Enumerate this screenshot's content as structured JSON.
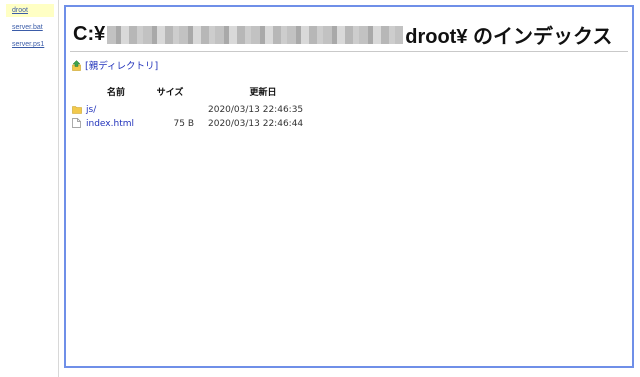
{
  "sidebar": {
    "items": [
      {
        "label": "droot",
        "active": true
      },
      {
        "label": "server.bat",
        "active": false
      },
      {
        "label": "server.ps1",
        "active": false
      }
    ]
  },
  "header": {
    "title_prefix": "C:¥",
    "title_suffix": "droot¥ のインデックス"
  },
  "parent_link": {
    "label": "[親ディレクトリ]",
    "icon": "folder-up-icon"
  },
  "table": {
    "columns": [
      "名前",
      "サイズ",
      "更新日"
    ],
    "rows": [
      {
        "icon": "folder-icon",
        "name": "js/",
        "size": "",
        "modified": "2020/03/13 22:46:35"
      },
      {
        "icon": "file-icon",
        "name": "index.html",
        "size": "75 B",
        "modified": "2020/03/13 22:46:44"
      }
    ]
  },
  "colors": {
    "frame_border": "#6f8fe8",
    "link": "#2233bb",
    "sidebar_active": "#ffffc4"
  }
}
